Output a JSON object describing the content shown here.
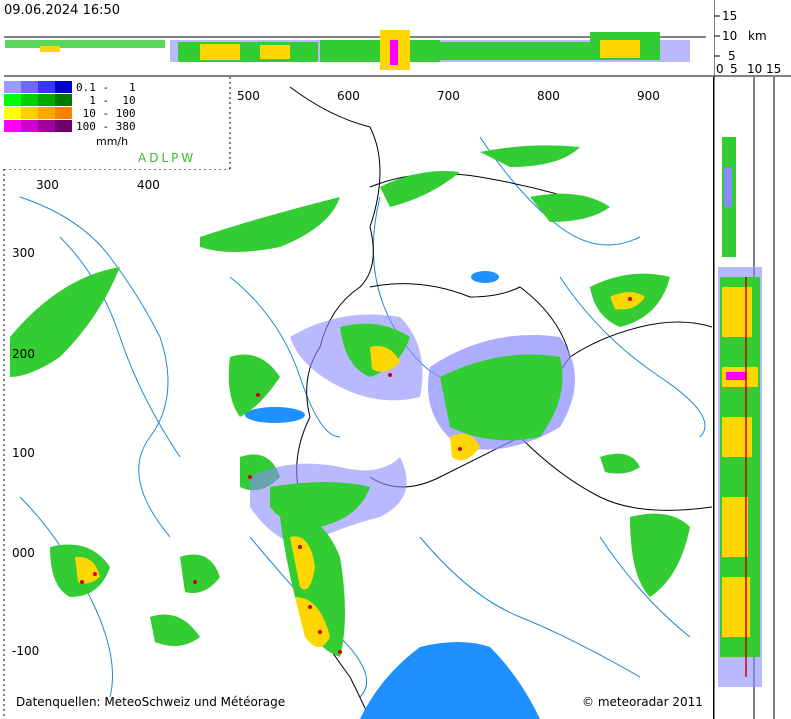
{
  "timestamp": "09.06.2024 16:50",
  "product": "ADLPW",
  "legend": {
    "unit": "mm/h",
    "rows": [
      {
        "range": "0.1 -   1",
        "colors": [
          "#9b9bff",
          "#6a6aff",
          "#3535ff",
          "#0000d0"
        ]
      },
      {
        "range": "  1 -  10",
        "colors": [
          "#00ff00",
          "#00d000",
          "#00a800",
          "#007800"
        ]
      },
      {
        "range": " 10 - 100",
        "colors": [
          "#ffff00",
          "#ffd000",
          "#ffa800",
          "#ff8000"
        ]
      },
      {
        "range": "100 - 380",
        "colors": [
          "#ff00ff",
          "#d000d0",
          "#a000a0",
          "#700070"
        ]
      }
    ]
  },
  "axes": {
    "top_x_ticks": [
      "500",
      "600",
      "700",
      "800",
      "900"
    ],
    "inner_x_ticks": [
      "300",
      "400"
    ],
    "left_y_ticks": [
      "300",
      "200",
      "100",
      "000",
      "-100"
    ],
    "height_ticks": [
      "15",
      "10",
      "5"
    ],
    "height_unit": "km",
    "right_scale_ticks": [
      "0",
      "5",
      "10",
      "15"
    ]
  },
  "footer": {
    "source": "Datenquellen: MeteoSchweiz und Météorage",
    "copyright": "© meteoradar 2011"
  },
  "colors": {
    "river": "#1e8ad0",
    "lake": "#1e90ff",
    "border": "#000000",
    "light_echo": "#8a8aff",
    "moderate_echo": "#33cc33",
    "heavy_echo": "#ffd700",
    "lightning": "#cc0000"
  }
}
